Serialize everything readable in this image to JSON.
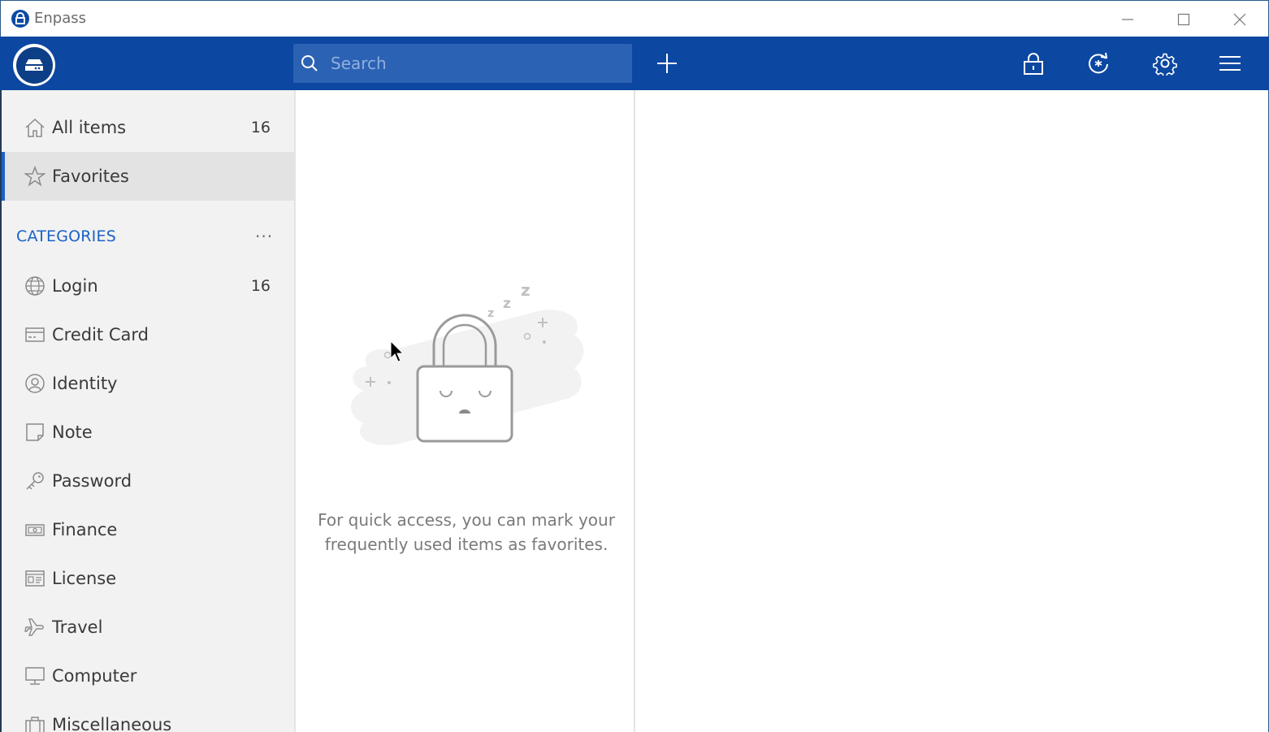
{
  "window": {
    "title": "Enpass",
    "minimize_icon": "minimize-icon",
    "maximize_icon": "maximize-icon",
    "close_icon": "close-icon"
  },
  "toolbar": {
    "search_placeholder": "Search",
    "icons": [
      "vault-icon",
      "search-icon",
      "add-icon",
      "lock-icon",
      "sync-icon",
      "gear-icon",
      "menu-icon"
    ],
    "background_color": "#0c47a1"
  },
  "sidebar": {
    "top_items": [
      {
        "label": "All items",
        "count": "16",
        "icon": "home-icon"
      },
      {
        "label": "Favorites",
        "count": "",
        "icon": "star-icon",
        "selected": true
      }
    ],
    "categories_header": "CATEGORIES",
    "categories_more": "···",
    "categories": [
      {
        "label": "Login",
        "count": "16",
        "icon": "globe-icon"
      },
      {
        "label": "Credit Card",
        "count": "",
        "icon": "credit-card-icon"
      },
      {
        "label": "Identity",
        "count": "",
        "icon": "identity-icon"
      },
      {
        "label": "Note",
        "count": "",
        "icon": "note-icon"
      },
      {
        "label": "Password",
        "count": "",
        "icon": "key-icon"
      },
      {
        "label": "Finance",
        "count": "",
        "icon": "money-icon"
      },
      {
        "label": "License",
        "count": "",
        "icon": "license-icon"
      },
      {
        "label": "Travel",
        "count": "",
        "icon": "plane-icon"
      },
      {
        "label": "Computer",
        "count": "",
        "icon": "computer-icon"
      },
      {
        "label": "Miscellaneous",
        "count": "",
        "icon": "briefcase-icon"
      }
    ],
    "accent_color": "#1a62c7"
  },
  "list_panel": {
    "empty_message": "For quick access, you can mark your frequently used items as favorites.",
    "illustration": "sleeping-lock-illustration"
  }
}
